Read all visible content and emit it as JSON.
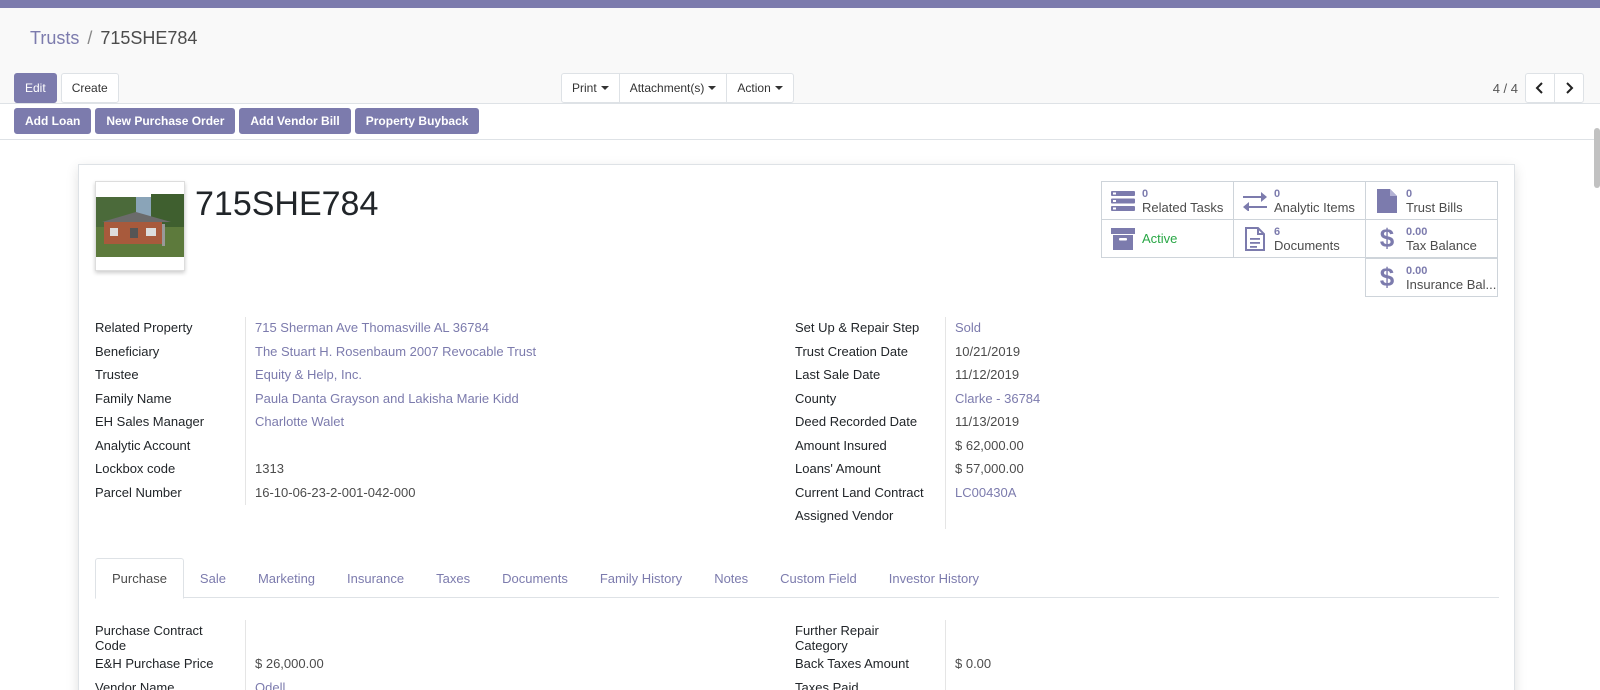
{
  "breadcrumb": {
    "parent": "Trusts",
    "current": "715SHE784"
  },
  "buttons": {
    "edit": "Edit",
    "create": "Create"
  },
  "sidebar": {
    "print": "Print",
    "attachments": "Attachment(s)",
    "action": "Action"
  },
  "pager": {
    "value": "4 / 4",
    "prev": "‹",
    "next": "›"
  },
  "statusbar": {
    "add_loan": "Add Loan",
    "new_po": "New Purchase Order",
    "add_vendor_bill": "Add Vendor Bill",
    "property_buyback": "Property Buyback"
  },
  "record": {
    "title": "715SHE784"
  },
  "smart_buttons": {
    "related_tasks": {
      "count": "0",
      "label": "Related Tasks"
    },
    "analytic_items": {
      "count": "0",
      "label": "Analytic Items"
    },
    "trust_bills": {
      "count": "0",
      "label": "Trust Bills"
    },
    "active": {
      "label": "Active"
    },
    "documents": {
      "count": "6",
      "label": "Documents"
    },
    "tax_balance": {
      "count": "0.00",
      "label": "Tax Balance"
    },
    "insurance_balance": {
      "count": "0.00",
      "label": "Insurance Bal..."
    }
  },
  "fields_left": [
    {
      "label": "Related Property",
      "value": "715 Sherman Ave Thomasville AL 36784",
      "link": true
    },
    {
      "label": "Beneficiary",
      "value": "The Stuart H. Rosenbaum 2007 Revocable Trust",
      "link": true
    },
    {
      "label": "Trustee",
      "value": "Equity & Help, Inc.",
      "link": true
    },
    {
      "label": "Family Name",
      "value": "Paula Danta Grayson and Lakisha Marie Kidd",
      "link": true
    },
    {
      "label": "EH Sales Manager",
      "value": "Charlotte Walet",
      "link": true
    },
    {
      "label": "Analytic Account",
      "value": "",
      "link": false
    },
    {
      "label": "Lockbox code",
      "value": "1313",
      "link": false
    },
    {
      "label": "Parcel Number",
      "value": "16-10-06-23-2-001-042-000",
      "link": false
    }
  ],
  "fields_right": [
    {
      "label": "Set Up & Repair Step",
      "value": "Sold",
      "link": true
    },
    {
      "label": "Trust Creation Date",
      "value": "10/21/2019",
      "link": false
    },
    {
      "label": "Last Sale Date",
      "value": "11/12/2019",
      "link": false
    },
    {
      "label": "County",
      "value": "Clarke - 36784",
      "link": true
    },
    {
      "label": "Deed Recorded Date",
      "value": "11/13/2019",
      "link": false
    },
    {
      "label": "Amount Insured",
      "value": "$ 62,000.00",
      "link": false
    },
    {
      "label": "Loans' Amount",
      "value": "$ 57,000.00",
      "link": false
    },
    {
      "label": "Current Land Contract",
      "value": "LC00430A",
      "link": true
    },
    {
      "label": "Assigned Vendor",
      "value": "",
      "link": false
    }
  ],
  "tabs": [
    "Purchase",
    "Sale",
    "Marketing",
    "Insurance",
    "Taxes",
    "Documents",
    "Family History",
    "Notes",
    "Custom Field",
    "Investor History"
  ],
  "purchase_left": [
    {
      "label": "Purchase Contract Code",
      "value": "",
      "link": false
    },
    {
      "label": "E&H Purchase Price",
      "value": "$ 26,000.00",
      "link": false
    },
    {
      "label": "Vendor Name",
      "value": "Odell",
      "link": true
    }
  ],
  "purchase_right": [
    {
      "label": "Further Repair Category",
      "value": "",
      "link": false
    },
    {
      "label": "Back Taxes Amount",
      "value": "$ 0.00",
      "link": false
    },
    {
      "label": "Taxes Paid",
      "value": "",
      "link": false
    }
  ],
  "colors": {
    "accent": "#7c7bad",
    "active": "#28a745"
  }
}
